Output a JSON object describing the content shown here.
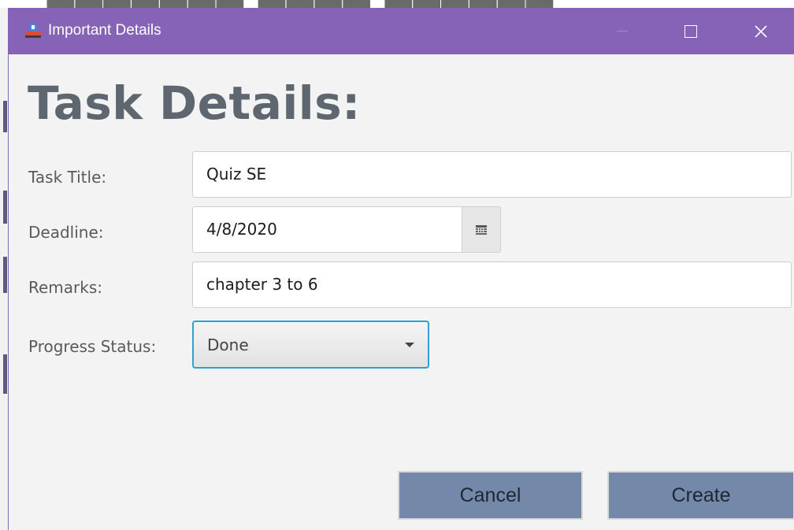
{
  "window": {
    "title": "Important Details",
    "app_icon": "app-logo-icon"
  },
  "form": {
    "heading": "Task Details:",
    "fields": {
      "task_title": {
        "label": "Task Title:",
        "value": "Quiz SE"
      },
      "deadline": {
        "label": "Deadline:",
        "value": "4/8/2020",
        "icon": "calendar-icon"
      },
      "remarks": {
        "label": "Remarks:",
        "value": "chapter 3 to 6"
      },
      "progress_status": {
        "label": "Progress Status:",
        "value": "Done",
        "icon": "chevron-down-icon"
      }
    }
  },
  "buttons": {
    "cancel": "Cancel",
    "create": "Create"
  },
  "colors": {
    "titlebar": "#8663b7",
    "button": "#7489a9",
    "focus": "#2f9fd6",
    "heading": "#5e6670"
  }
}
